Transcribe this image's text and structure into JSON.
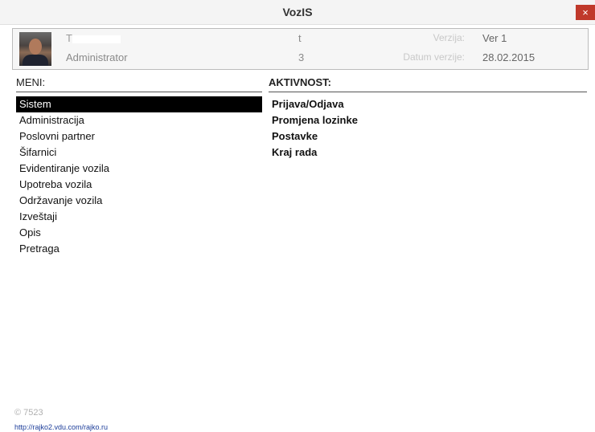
{
  "window": {
    "title": "VozIS",
    "close_label": "×"
  },
  "header": {
    "user_name": "T",
    "user_role": "Administrator",
    "value1": "t",
    "value2": "3",
    "version_label": "Verzija:",
    "version_value": "Ver 1",
    "date_label": "Datum verzije:",
    "date_value": "28.02.2015"
  },
  "menu": {
    "heading": "MENI:",
    "items": [
      {
        "label": "Sistem",
        "selected": true
      },
      {
        "label": "Administracija"
      },
      {
        "label": "Poslovni partner"
      },
      {
        "label": "Šifarnici"
      },
      {
        "label": "Evidentiranje vozila"
      },
      {
        "label": "Upotreba vozila"
      },
      {
        "label": "Održavanje vozila"
      },
      {
        "label": "Izveštaji"
      },
      {
        "label": "Opis"
      },
      {
        "label": "Pretraga"
      }
    ]
  },
  "activity": {
    "heading": "AKTIVNOST:",
    "items": [
      {
        "label": "Prijava/Odjava"
      },
      {
        "label": "Promjena lozinke"
      },
      {
        "label": "Postavke"
      },
      {
        "label": "Kraj rada"
      }
    ]
  },
  "footer": {
    "code": "© 7523",
    "link": "http://rajko2.vdu.com/rajko.ru"
  }
}
